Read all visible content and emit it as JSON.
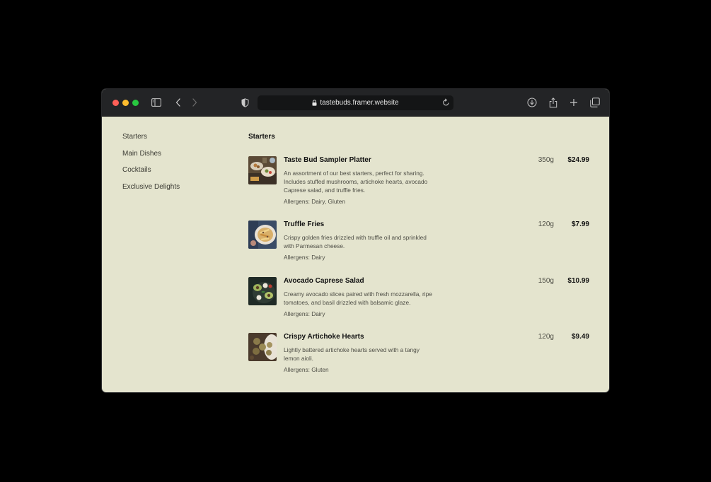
{
  "browser": {
    "url": "tastebuds.framer.website",
    "icons": [
      "sidebar-icon",
      "back-icon",
      "forward-icon",
      "shield-icon",
      "lock-icon",
      "reload-icon",
      "download-icon",
      "share-icon",
      "new-tab-icon",
      "tabs-overview-icon"
    ]
  },
  "nav": {
    "items": [
      {
        "label": "Starters"
      },
      {
        "label": "Main Dishes"
      },
      {
        "label": "Cocktails"
      },
      {
        "label": "Exclusive Delights"
      }
    ]
  },
  "section": {
    "title": "Starters"
  },
  "menu": {
    "items": [
      {
        "name": "Taste Bud Sampler Platter",
        "description": "An assortment of our best starters, perfect for sharing. Includes stuffed mushrooms, artichoke hearts, avocado Caprese salad, and truffle fries.",
        "allergens": "Allergens: Dairy, Gluten",
        "weight": "350g",
        "price": "$24.99"
      },
      {
        "name": "Truffle Fries",
        "description": "Crispy golden fries drizzled with truffle oil and sprinkled with Parmesan cheese.",
        "allergens": "Allergens: Dairy",
        "weight": "120g",
        "price": "$7.99"
      },
      {
        "name": "Avocado Caprese Salad",
        "description": "Creamy avocado slices paired with fresh mozzarella, ripe tomatoes, and basil drizzled with balsamic glaze.",
        "allergens": "Allergens: Dairy",
        "weight": "150g",
        "price": "$10.99"
      },
      {
        "name": "Crispy Artichoke Hearts",
        "description": "Lightly battered artichoke hearts served with a tangy lemon aioli.",
        "allergens": "Allergens: Gluten",
        "weight": "120g",
        "price": "$9.49"
      }
    ]
  },
  "colors": {
    "page_background": "#000000",
    "toolbar": "#232426",
    "content_background": "#e4e4ce",
    "close": "#ff5f57",
    "minimize": "#febc2e",
    "maximize": "#28c840"
  }
}
